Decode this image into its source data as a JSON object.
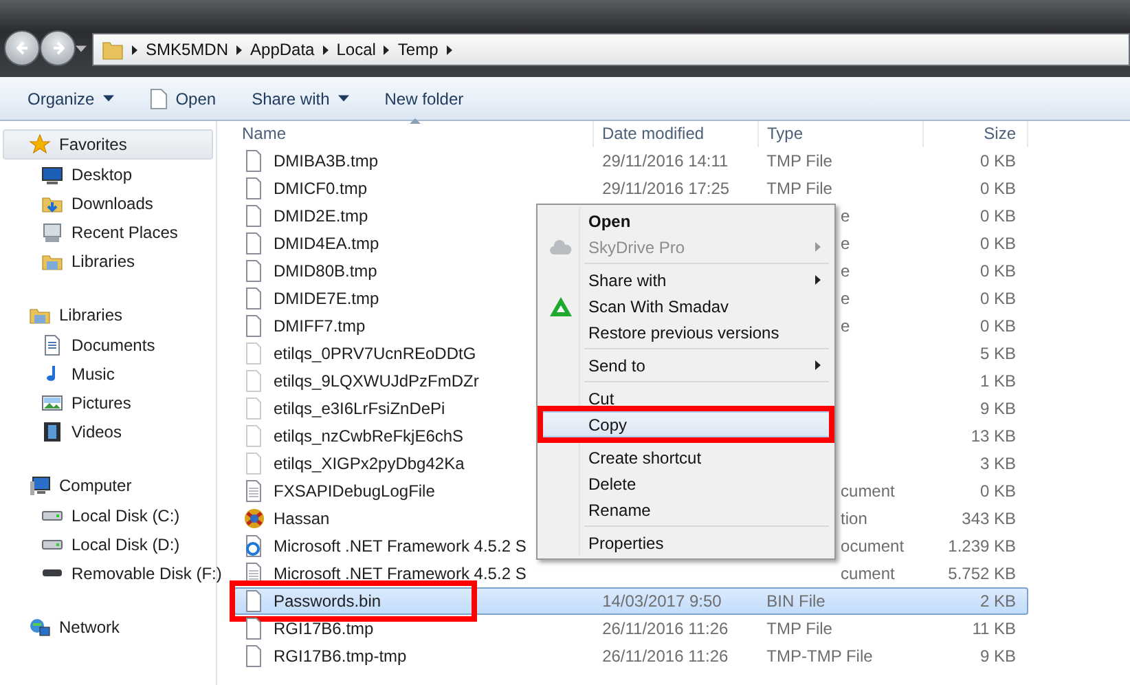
{
  "address_bar": {
    "crumbs": [
      "SMK5MDN",
      "AppData",
      "Local",
      "Temp"
    ]
  },
  "toolbar": [
    {
      "label": "Organize",
      "dropdown": true,
      "icon": false
    },
    {
      "label": "Open",
      "dropdown": false,
      "icon": true
    },
    {
      "label": "Share with",
      "dropdown": true,
      "icon": false
    },
    {
      "label": "New folder",
      "dropdown": false,
      "icon": false
    }
  ],
  "sidebar": {
    "groups": [
      {
        "label": "Favorites",
        "selected": true,
        "children": [
          {
            "label": "Desktop"
          },
          {
            "label": "Downloads"
          },
          {
            "label": "Recent Places"
          },
          {
            "label": "Libraries"
          }
        ]
      },
      {
        "label": "Libraries",
        "selected": false,
        "children": [
          {
            "label": "Documents"
          },
          {
            "label": "Music"
          },
          {
            "label": "Pictures"
          },
          {
            "label": "Videos"
          }
        ]
      },
      {
        "label": "Computer",
        "selected": false,
        "children": [
          {
            "label": "Local Disk (C:)"
          },
          {
            "label": "Local Disk (D:)"
          },
          {
            "label": "Removable Disk (F:)"
          }
        ]
      },
      {
        "label": "Network",
        "selected": false
      }
    ]
  },
  "file_list": {
    "columns": [
      "Name",
      "Date modified",
      "Type",
      "Size"
    ],
    "rows": [
      {
        "name": "DMIBA3B.tmp",
        "date": "29/11/2016 14:11",
        "type": "TMP File",
        "size": "0 KB",
        "kind": "file",
        "selected": false,
        "annotated": false
      },
      {
        "name": "DMICF0.tmp",
        "date": "29/11/2016 17:25",
        "type": "TMP File",
        "size": "0 KB",
        "kind": "file",
        "selected": false,
        "annotated": false
      },
      {
        "name": "DMID2E.tmp",
        "type": "e",
        "size": "0 KB",
        "kind": "file",
        "selected": false,
        "annotated": false
      },
      {
        "name": "DMID4EA.tmp",
        "type": "e",
        "size": "0 KB",
        "kind": "file",
        "selected": false,
        "annotated": false
      },
      {
        "name": "DMID80B.tmp",
        "type": "e",
        "size": "0 KB",
        "kind": "file",
        "selected": false,
        "annotated": false
      },
      {
        "name": "DMIDE7E.tmp",
        "type": "e",
        "size": "0 KB",
        "kind": "file",
        "selected": false,
        "annotated": false
      },
      {
        "name": "DMIFF7.tmp",
        "type": "e",
        "size": "0 KB",
        "kind": "file",
        "selected": false,
        "annotated": false
      },
      {
        "name": "etilqs_0PRV7UcnREoDDtG",
        "size": "5 KB",
        "kind": "temp",
        "selected": false,
        "annotated": false
      },
      {
        "name": "etilqs_9LQXWUJdPzFmDZr",
        "size": "1 KB",
        "kind": "temp",
        "selected": false,
        "annotated": false
      },
      {
        "name": "etilqs_e3I6LrFsiZnDePi",
        "size": "9 KB",
        "kind": "temp",
        "selected": false,
        "annotated": false
      },
      {
        "name": "etilqs_nzCwbReFkjE6chS",
        "size": "13 KB",
        "kind": "temp",
        "selected": false,
        "annotated": false
      },
      {
        "name": "etilqs_XIGPx2pyDbg42Ka",
        "size": "3 KB",
        "kind": "temp",
        "selected": false,
        "annotated": false
      },
      {
        "name": "FXSAPIDebugLogFile",
        "type": "cument",
        "size": "0 KB",
        "kind": "text",
        "selected": false,
        "annotated": false
      },
      {
        "name": "Hassan",
        "type": "tion",
        "size": "343 KB",
        "kind": "app",
        "selected": false,
        "annotated": false
      },
      {
        "name": "Microsoft .NET Framework 4.5.2 S",
        "type": "ocument",
        "size": "1.239 KB",
        "kind": "web",
        "selected": false,
        "annotated": false
      },
      {
        "name": "Microsoft .NET Framework 4.5.2 S",
        "type": "cument",
        "size": "5.752 KB",
        "kind": "text",
        "selected": false,
        "annotated": false
      },
      {
        "name": "Passwords.bin",
        "date": "14/03/2017 9:50",
        "type": "BIN File",
        "size": "2 KB",
        "kind": "file",
        "selected": true,
        "annotated": true
      },
      {
        "name": "RGI17B6.tmp",
        "date": "26/11/2016 11:26",
        "type": "TMP File",
        "size": "11 KB",
        "kind": "file",
        "selected": false,
        "annotated": false
      },
      {
        "name": "RGI17B6.tmp-tmp",
        "date": "26/11/2016 11:26",
        "type": "TMP-TMP File",
        "size": "9 KB",
        "kind": "file",
        "selected": false,
        "annotated": false
      }
    ]
  },
  "context_menu": [
    {
      "kind": "default",
      "label": "Open",
      "disabled": false,
      "submenu": false,
      "selected": false,
      "annotated": false
    },
    {
      "kind": "item",
      "label": "SkyDrive Pro",
      "disabled": true,
      "submenu": true,
      "selected": false,
      "annotated": false
    },
    {
      "kind": "separator"
    },
    {
      "kind": "item",
      "label": "Share with",
      "disabled": false,
      "submenu": true,
      "selected": false,
      "annotated": false
    },
    {
      "kind": "item",
      "label": "Scan With Smadav",
      "disabled": false,
      "submenu": false,
      "selected": false,
      "annotated": false
    },
    {
      "kind": "item",
      "label": "Restore previous versions",
      "disabled": false,
      "submenu": false,
      "selected": false,
      "annotated": false
    },
    {
      "kind": "separator"
    },
    {
      "kind": "item",
      "label": "Send to",
      "disabled": false,
      "submenu": true,
      "selected": false,
      "annotated": false
    },
    {
      "kind": "separator"
    },
    {
      "kind": "item",
      "label": "Cut",
      "disabled": false,
      "submenu": false,
      "selected": false,
      "annotated": false
    },
    {
      "kind": "item",
      "label": "Copy",
      "disabled": false,
      "submenu": false,
      "selected": true,
      "annotated": true
    },
    {
      "kind": "separator"
    },
    {
      "kind": "item",
      "label": "Create shortcut",
      "disabled": false,
      "submenu": false,
      "selected": false,
      "annotated": false
    },
    {
      "kind": "item",
      "label": "Delete",
      "disabled": false,
      "submenu": false,
      "selected": false,
      "annotated": false
    },
    {
      "kind": "item",
      "label": "Rename",
      "disabled": false,
      "submenu": false,
      "selected": false,
      "annotated": false
    },
    {
      "kind": "separator"
    },
    {
      "kind": "item",
      "label": "Properties",
      "disabled": false,
      "submenu": false,
      "selected": false,
      "annotated": false
    }
  ]
}
